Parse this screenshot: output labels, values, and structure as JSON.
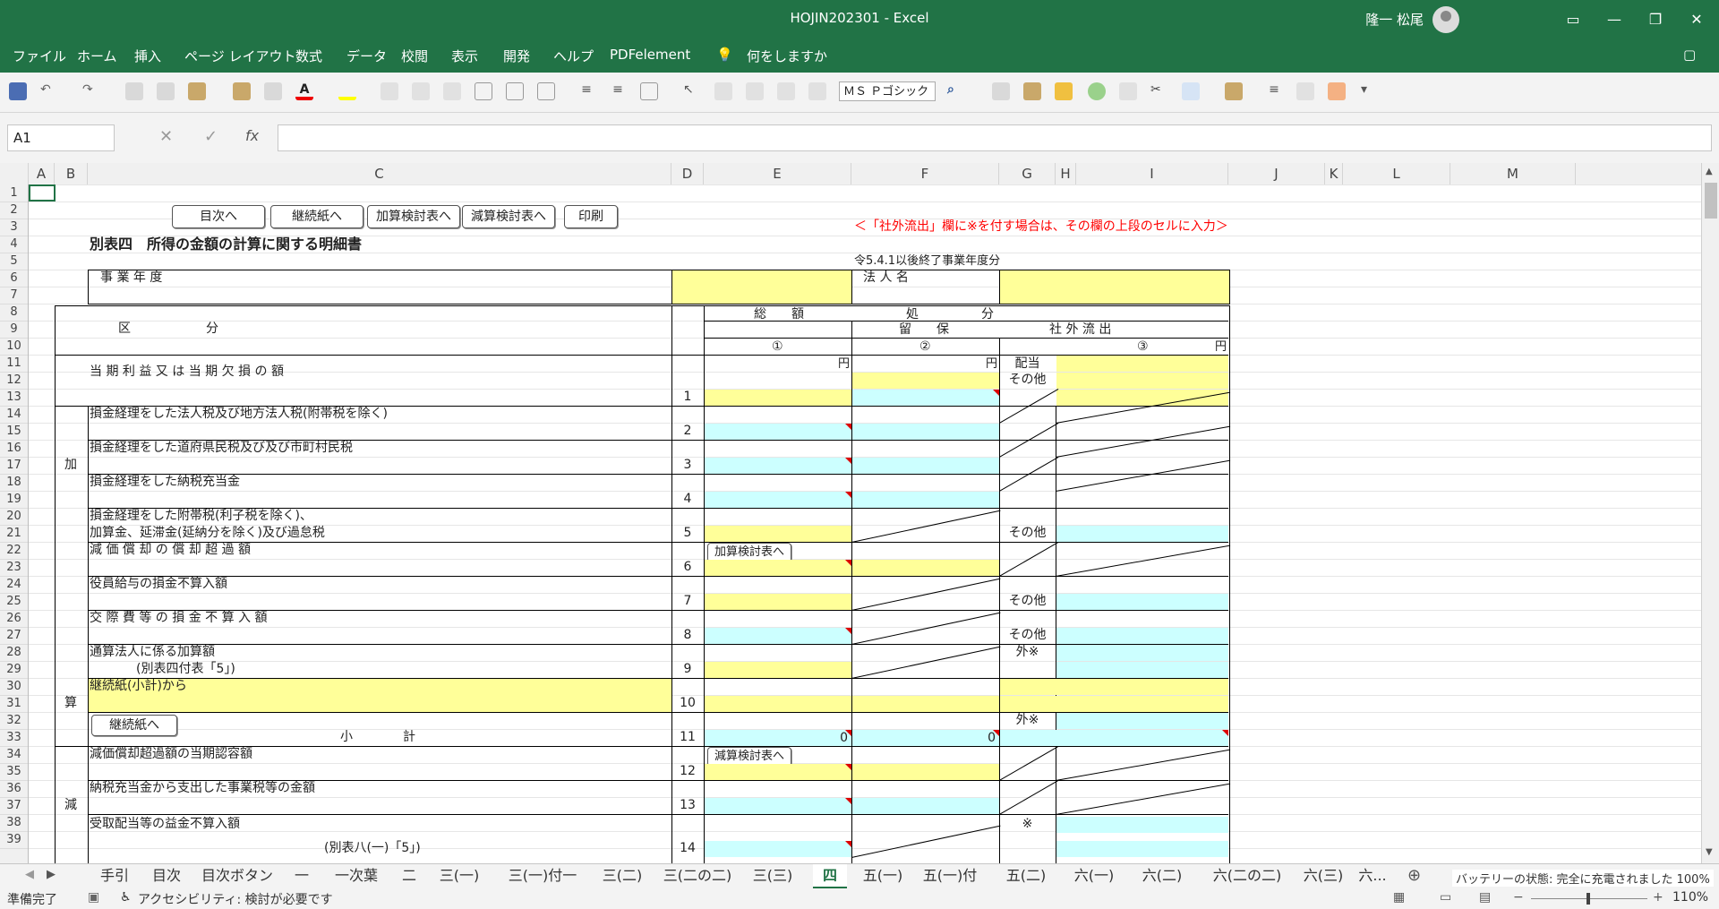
{
  "window": {
    "title": "HOJIN202301  -  Excel",
    "user": "隆一 松尾",
    "minimize_glyph": "—",
    "maximize_glyph": "❐",
    "close_glyph": "✕"
  },
  "menu": [
    "ファイル",
    "ホーム",
    "挿入",
    "ページ レイアウト",
    "数式",
    "データ",
    "校閲",
    "表示",
    "開発",
    "ヘルプ",
    "PDFelement",
    "何をしますか"
  ],
  "qat": {
    "font_name": "ＭＳ Ｐゴシック"
  },
  "formula_bar": {
    "name_box": "A1",
    "fx_label": "fx"
  },
  "columns": [
    "A",
    "B",
    "C",
    "D",
    "E",
    "F",
    "G",
    "H",
    "I",
    "J",
    "K",
    "L",
    "M"
  ],
  "rows": [
    "1",
    "2",
    "3",
    "4",
    "5",
    "6",
    "7",
    "8",
    "9",
    "10",
    "11",
    "12",
    "13",
    "14",
    "15",
    "16",
    "17",
    "18",
    "19",
    "20",
    "21",
    "22",
    "23",
    "24",
    "25",
    "26",
    "27",
    "28",
    "29",
    "30",
    "31",
    "32",
    "33",
    "34",
    "35",
    "36",
    "37",
    "38",
    "39"
  ],
  "sheet": {
    "buttons": {
      "toc": "目次へ",
      "continuation": "継続紙へ",
      "add_sheet": "加算検討表へ",
      "sub_sheet": "減算検討表へ",
      "print": "印刷"
    },
    "note": "＜「社外流出」欄に※を付す場合は、その欄の上段のセルに入力＞",
    "title": "別表四　所得の金額の計算に関する明細書",
    "applicability": "令5.4.1以後終了事業年度分",
    "fiscal_year": "事 業 年 度",
    "corp_name": "法 人 名",
    "header": {
      "category": "区　　　　　　分",
      "total": "総　　額",
      "disposition": "処　　　　　分",
      "retained": "留　　保",
      "outflow": "社 外 流 出",
      "col1": "①",
      "col2": "②",
      "col3": "③",
      "yen": "円"
    },
    "side_add": "加",
    "side_add2": "算",
    "side_sub": "減",
    "haitou": "配当",
    "sonota": "その他",
    "gai": "外※",
    "kome": "※",
    "items": {
      "i1": "当 期 利 益 又 は 当 期 欠 損 の 額",
      "i2": "損金経理をした法人税及び地方法人税(附帯税を除く)",
      "i3": "損金経理をした道府県民税及び及び市町村民税",
      "i4": "損金経理をした納税充当金",
      "i5a": "損金経理をした附帯税(利子税を除く)、",
      "i5b": "加算金、延滞金(延納分を除く)及び過怠税",
      "i6": "減 価 償 却 の 償 却 超 過 額",
      "i7": "役員給与の損金不算入額",
      "i8": "交 際 費 等 の 損 金 不 算 入 額",
      "i9a": "通算法人に係る加算額",
      "i9b": "(別表四付表「5」)",
      "i10": "継続紙(小計)から",
      "i11": "小　　　　計",
      "i12": "減価償却超過額の当期認容額",
      "i13": "納税充当金から支出した事業税等の金額",
      "i14a": "受取配当等の益金不算入額",
      "i14b": "(別表八(一)「5」)"
    },
    "nums": [
      "1",
      "2",
      "3",
      "4",
      "5",
      "6",
      "7",
      "8",
      "9",
      "10",
      "11",
      "12",
      "13",
      "14"
    ],
    "subtotal_e": "0",
    "subtotal_f": "0"
  },
  "tabs": [
    "手引",
    "目次",
    "目次ボタン",
    "一",
    "一次葉",
    "二",
    "三(一)",
    "三(一)付一",
    "三(二)",
    "三(二の二)",
    "三(三)",
    "四",
    "五(一)",
    "五(一)付",
    "五(二)",
    "六(一)",
    "六(二)",
    "六(二の二)",
    "六(三)",
    "六..."
  ],
  "status": {
    "ready": "準備完了",
    "accessibility": "アクセシビリティ: 検討が必要です",
    "battery": "バッテリーの状態: 完全に充電されました 100%",
    "zoom": "110%"
  }
}
